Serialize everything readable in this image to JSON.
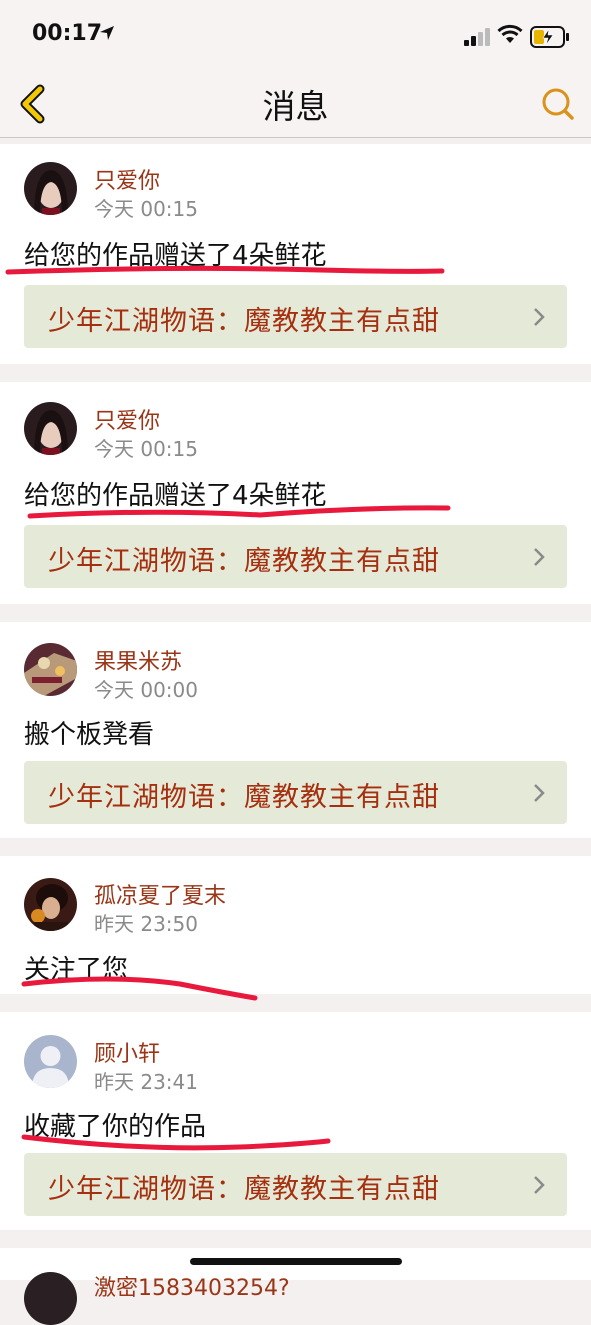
{
  "status": {
    "time": "00:17"
  },
  "nav": {
    "title": "消息"
  },
  "messages": [
    {
      "user": "只爱你",
      "time": "今天 00:15",
      "text": "给您的作品赠送了4朵鲜花",
      "work": "少年江湖物语：魔教教主有点甜"
    },
    {
      "user": "只爱你",
      "time": "今天 00:15",
      "text": "给您的作品赠送了4朵鲜花",
      "work": "少年江湖物语：魔教教主有点甜"
    },
    {
      "user": "果果米苏",
      "time": "今天 00:00",
      "text": "搬个板凳看",
      "work": "少年江湖物语：魔教教主有点甜"
    },
    {
      "user": "孤凉夏了夏末",
      "time": "昨天 23:50",
      "text": "关注了您"
    },
    {
      "user": "顾小轩",
      "time": "昨天 23:41",
      "text": "收藏了你的作品",
      "work": "少年江湖物语：魔教教主有点甜"
    },
    {
      "user": "激密1583403254?"
    }
  ],
  "colors": {
    "accent": "#e0b800",
    "username": "#9a3516",
    "work_title": "#a5300f",
    "underline": "#e8193c"
  }
}
